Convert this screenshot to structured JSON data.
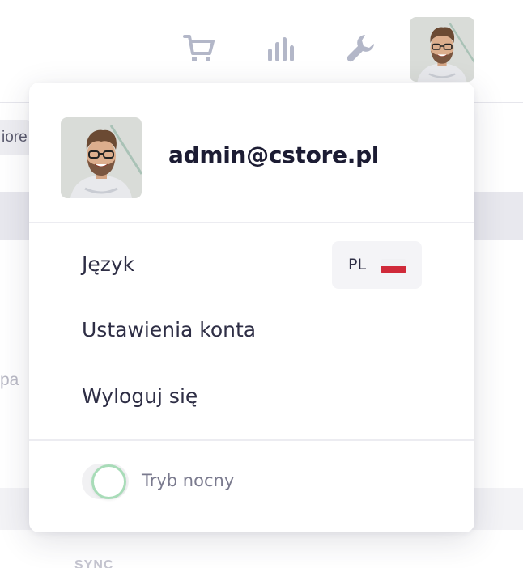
{
  "topbar": {
    "icons": [
      "cart-icon",
      "chart-icon",
      "wrench-icon"
    ],
    "icon_color": "#b3b7c8",
    "avatar_name": "avatar"
  },
  "background": {
    "chip_text": "iore",
    "frag_text": "pa",
    "sync_text": "SYNC"
  },
  "dropdown": {
    "email": "admin@cstore.pl",
    "menu": {
      "language_label": "Język",
      "language_code": "PL",
      "account_settings_label": "Ustawienia konta",
      "logout_label": "Wyloguj się"
    },
    "night_mode": {
      "label": "Tryb nocny",
      "enabled": false,
      "accent": "#a8dcb8"
    }
  },
  "colors": {
    "text_dark": "#1c1c33",
    "text_menu": "#2e2e45",
    "text_muted": "#7a7a8e",
    "flag_red": "#d02a3a"
  }
}
